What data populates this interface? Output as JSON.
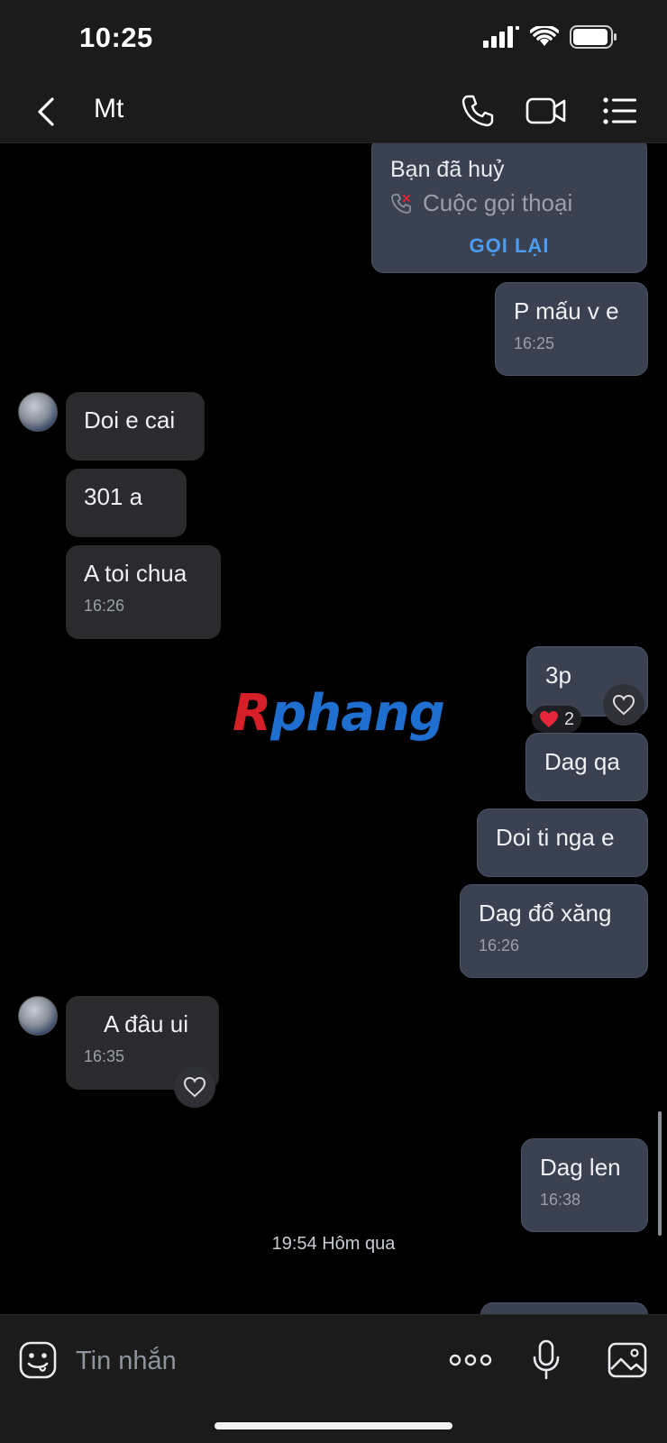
{
  "status_bar": {
    "time": "10:25"
  },
  "header": {
    "contact_name": "Mt"
  },
  "call_card": {
    "title": "Bạn đã huỷ",
    "subtitle": "Cuộc gọi thoại",
    "action": "GỌI LẠI"
  },
  "messages": [
    {
      "side": "sent",
      "text": "P mấu v e",
      "time": "16:25"
    },
    {
      "side": "received",
      "text": "Doi e cai"
    },
    {
      "side": "received",
      "text": "301 a"
    },
    {
      "side": "received",
      "text": "A toi chua",
      "time": "16:26"
    },
    {
      "side": "sent",
      "text": "3p",
      "reaction": {
        "emoji": "❤️",
        "count": "2"
      }
    },
    {
      "side": "sent",
      "text": "Dag qa"
    },
    {
      "side": "sent",
      "text": "Doi ti nga e"
    },
    {
      "side": "sent",
      "text": "Dag đổ xăng",
      "time": "16:26"
    },
    {
      "side": "received",
      "text": "A đâu ui",
      "time": "16:35"
    },
    {
      "side": "sent",
      "text": "Dag len",
      "time": "16:38"
    }
  ],
  "date_separator": "19:54 Hôm qua",
  "watermark": {
    "first": "R",
    "rest": "phang"
  },
  "input": {
    "placeholder": "Tin nhắn"
  },
  "colors": {
    "background": "#000000",
    "bar": "#1b1b1c",
    "sent_bubble": "#3a4150",
    "received_bubble": "#2b2b2d",
    "link": "#4a9cf5",
    "heart": "#e5263b"
  },
  "icons": [
    "back-icon",
    "phone-icon",
    "video-icon",
    "menu-icon",
    "emoji-icon",
    "more-icon",
    "mic-icon",
    "image-icon",
    "heart-icon",
    "missed-call-icon"
  ]
}
